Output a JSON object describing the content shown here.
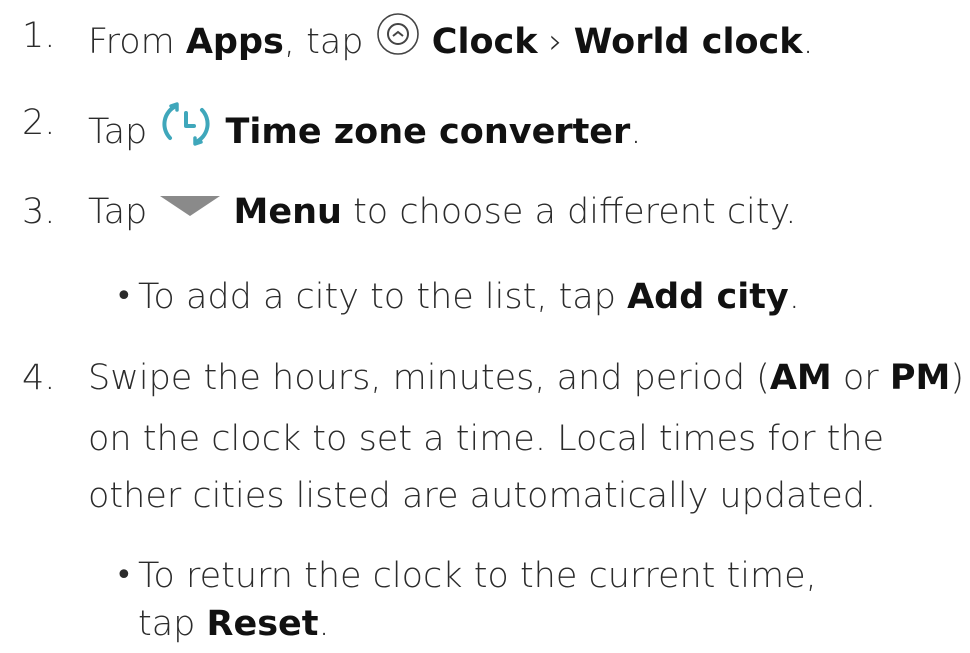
{
  "steps": [
    {
      "number": "1.",
      "text_1": "From ",
      "bold_1": "Apps",
      "text_2": ", tap ",
      "icon": "clock-app-icon",
      "bold_2": "Clock",
      "separator": " › ",
      "bold_3": "World clock",
      "text_3": "."
    },
    {
      "number": "2.",
      "text_1": "Tap ",
      "icon": "time-zone-converter-icon",
      "bold_1": "Time zone converter",
      "text_2": "."
    },
    {
      "number": "3.",
      "text_1": "Tap ",
      "icon": "menu-triangle-icon",
      "bold_1": "Menu",
      "text_2": " to choose a different city.",
      "bullet": {
        "text_1": "To add a city to the list, tap ",
        "bold_1": "Add city",
        "text_2": "."
      }
    },
    {
      "number": "4.",
      "text_1": "Swipe the hours, minutes, and period (",
      "bold_1": "AM",
      "text_2": " or ",
      "bold_2": "PM",
      "text_3": ")",
      "line_2": "on the clock to set a time. Local times for the",
      "line_3": "other cities listed are automatically updated.",
      "bullet": {
        "text_1": "To return the clock to the current time,",
        "text_2": "tap ",
        "bold_1": "Reset",
        "text_3": "."
      }
    }
  ],
  "colors": {
    "icon_teal": "#3fa7bb",
    "menu_triangle": "#8a8a8a",
    "text": "#2b2b2b"
  }
}
